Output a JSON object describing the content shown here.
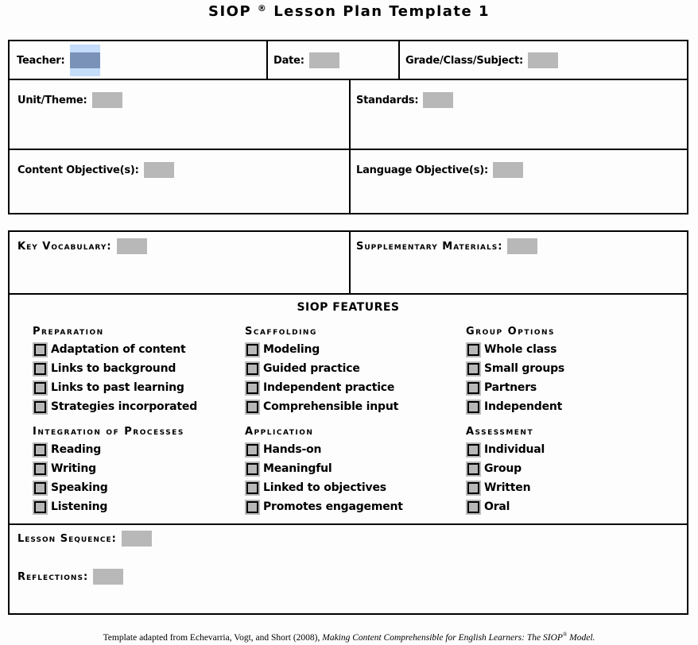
{
  "title": {
    "text_left": "SIOP",
    "registered_mark": "®",
    "text_right": "Lesson Plan Template 1"
  },
  "header_row": {
    "teacher_label": "Teacher:",
    "teacher_value": "",
    "date_label": "Date:",
    "date_value": "",
    "grade_label": "Grade/Class/Subject:",
    "grade_value": ""
  },
  "unit_row": {
    "unit_label": "Unit/Theme:",
    "unit_value": "",
    "standards_label": "Standards:",
    "standards_value": ""
  },
  "objectives_row": {
    "content_label": "Content Objective(s):",
    "content_value": "",
    "language_label": "Language Objective(s):",
    "language_value": ""
  },
  "materials_row": {
    "vocab_label": "Key Vocabulary:",
    "vocab_value": "",
    "supp_label": "Supplementary Materials:",
    "supp_value": ""
  },
  "features": {
    "title": "SIOP FEATURES",
    "groups": [
      {
        "title": "Preparation",
        "items": [
          "Adaptation of content",
          "Links to background",
          "Links to past learning",
          "Strategies incorporated"
        ]
      },
      {
        "title": "Scaffolding",
        "items": [
          "Modeling",
          "Guided practice",
          "Independent practice",
          "Comprehensible input"
        ]
      },
      {
        "title": "Group Options",
        "items": [
          "Whole class",
          "Small groups",
          "Partners",
          "Independent"
        ]
      },
      {
        "title": "Integration of Processes",
        "items": [
          "Reading",
          "Writing",
          "Speaking",
          "Listening"
        ]
      },
      {
        "title": "Application",
        "items": [
          "Hands-on",
          "Meaningful",
          "Linked to objectives",
          "Promotes engagement"
        ]
      },
      {
        "title": "Assessment",
        "items": [
          "Individual",
          "Group",
          "Written",
          "Oral"
        ]
      }
    ]
  },
  "sequence": {
    "lesson_label": "Lesson Sequence:",
    "lesson_value": "",
    "reflections_label": "Reflections:",
    "reflections_value": ""
  },
  "footer": {
    "prefix": "Template adapted from Echevarria, Vogt, and Short (2008), ",
    "book_title": "Making Content Comprehensible for English Learners: The SIOP",
    "mark": "®",
    "suffix": " Model."
  },
  "colors": {
    "field_fill": "#b8b8b8",
    "selected_field": "#7b92b8",
    "selection_highlight": "#c5dcfb",
    "border": "#000000"
  }
}
